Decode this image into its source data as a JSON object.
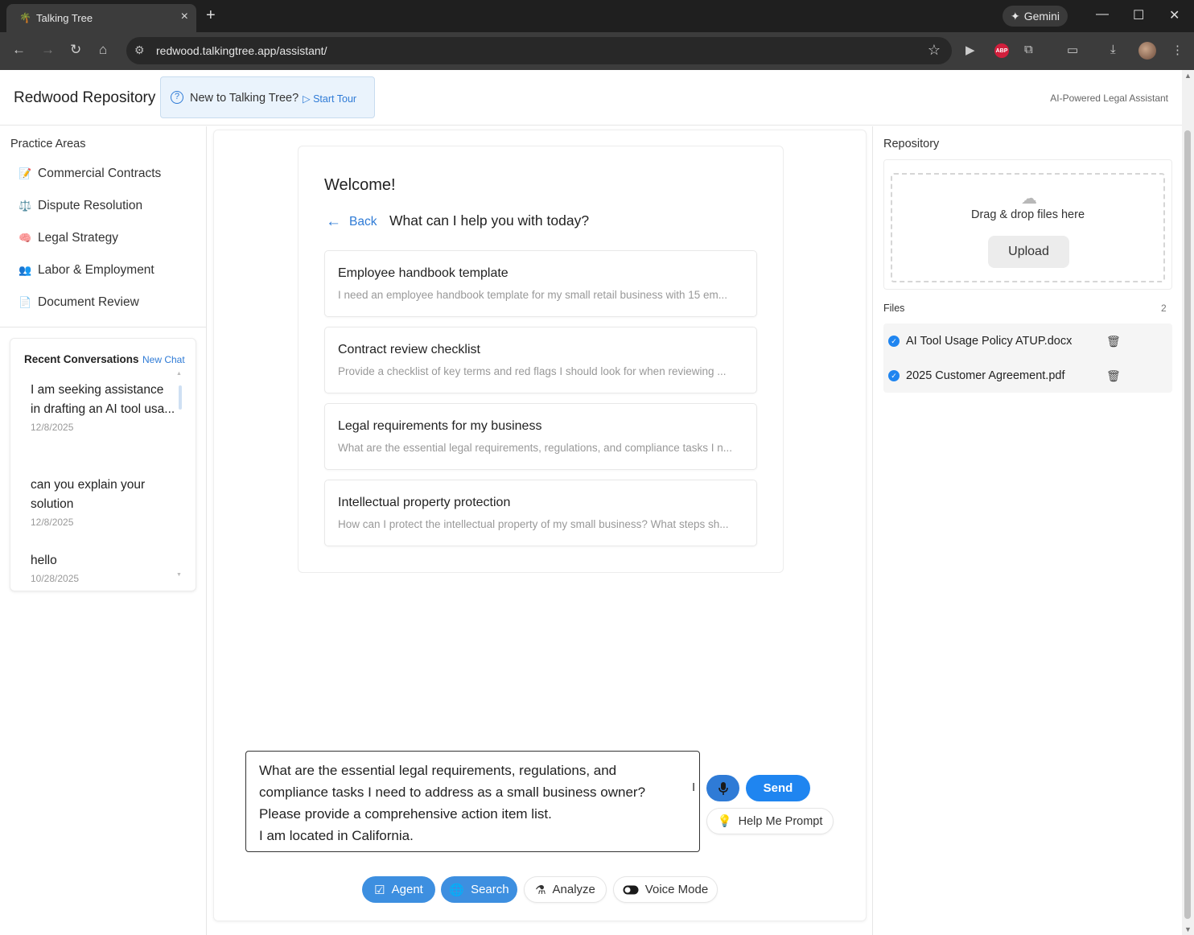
{
  "browser": {
    "tab_title": "Talking Tree",
    "url": "redwood.talkingtree.app/assistant/",
    "gemini_label": "Gemini",
    "abp_label": "ABP"
  },
  "header": {
    "brand": "Redwood Repository",
    "tour_text": "New to Talking Tree?",
    "tour_link": "Start Tour",
    "tagline": "AI-Powered Legal Assistant"
  },
  "sidebar": {
    "section_title": "Practice Areas",
    "items": [
      {
        "icon": "📝",
        "label": "Commercial Contracts"
      },
      {
        "icon": "⚖️",
        "label": "Dispute Resolution"
      },
      {
        "icon": "🧠",
        "label": "Legal Strategy"
      },
      {
        "icon": "👥",
        "label": "Labor & Employment"
      },
      {
        "icon": "📄",
        "label": "Document Review"
      }
    ],
    "recent_title": "Recent Conversations",
    "new_chat": "New Chat",
    "conversations": [
      {
        "text": "I am seeking assistance in drafting an AI tool usa...",
        "date": "12/8/2025"
      },
      {
        "text": "can you explain your solution",
        "date": "12/8/2025"
      },
      {
        "text": "hello",
        "date": "10/28/2025"
      }
    ]
  },
  "main": {
    "welcome": "Welcome!",
    "back": "Back",
    "question": "What can I help you with today?",
    "prompts": [
      {
        "title": "Employee handbook template",
        "desc": "I need an employee handbook template for my small retail business with 15 em..."
      },
      {
        "title": "Contract review checklist",
        "desc": "Provide a checklist of key terms and red flags I should look for when reviewing ..."
      },
      {
        "title": "Legal requirements for my business",
        "desc": "What are the essential legal requirements, regulations, and compliance tasks I n..."
      },
      {
        "title": "Intellectual property protection",
        "desc": "How can I protect the intellectual property of my small business? What steps sh..."
      }
    ],
    "composer_value": "What are the essential legal requirements, regulations, and compliance tasks I need to address as a small business owner?\nPlease provide a comprehensive action item list.\nI am located in California.",
    "send": "Send",
    "help_me_prompt": "Help Me Prompt",
    "modes": {
      "agent": "Agent",
      "search": "Search",
      "analyze": "Analyze",
      "voice": "Voice Mode"
    }
  },
  "repository": {
    "title": "Repository",
    "drop_text": "Drag & drop files here",
    "upload": "Upload",
    "files_label": "Files",
    "files_count": "2",
    "files": [
      {
        "name": "AI Tool Usage Policy ATUP.docx"
      },
      {
        "name": "2025 Customer Agreement.pdf"
      }
    ]
  }
}
